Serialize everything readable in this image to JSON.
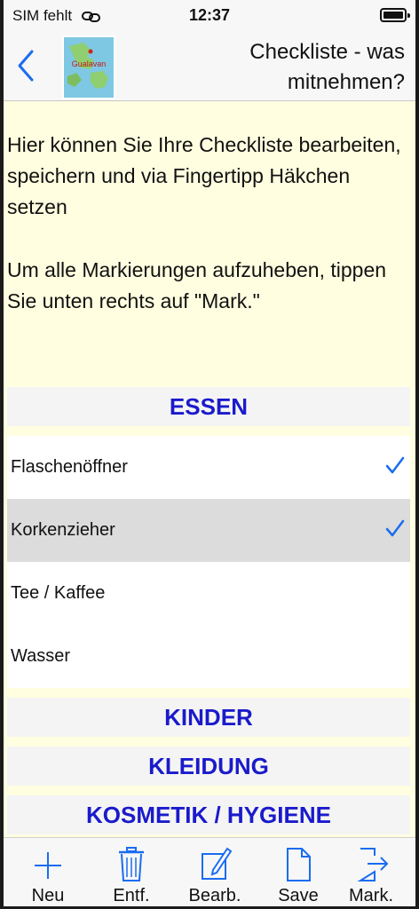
{
  "status_bar": {
    "carrier": "SIM fehlt",
    "link_icon": "link-icon",
    "time": "12:37",
    "battery_icon": "battery-icon"
  },
  "nav": {
    "back_icon": "chevron-left-icon",
    "logo_text": "Gualavan",
    "title": "Checkliste - was mitnehmen?"
  },
  "intro": {
    "paragraph_1": "Hier können Sie Ihre Checkliste bearbeiten, speichern und via Fingertipp Häkchen setzen",
    "paragraph_2": "Um alle Markierungen aufzuheben, tippen Sie unten rechts auf \"Mark.\""
  },
  "checklist": {
    "sections": [
      {
        "title": "ESSEN",
        "items": [
          {
            "label": "Flaschenöffner",
            "checked": true,
            "selected": false
          },
          {
            "label": "Korkenzieher",
            "checked": true,
            "selected": true
          },
          {
            "label": "Tee / Kaffee",
            "checked": false,
            "selected": false
          },
          {
            "label": "Wasser",
            "checked": false,
            "selected": false
          }
        ]
      },
      {
        "title": "KINDER",
        "items": []
      },
      {
        "title": "KLEIDUNG",
        "items": []
      },
      {
        "title": "KOSMETIK / HYGIENE",
        "items": []
      }
    ]
  },
  "toolbar": {
    "new_label": "Neu",
    "delete_label": "Entf.",
    "edit_label": "Bearb.",
    "save_label": "Save",
    "mark_label": "Mark."
  },
  "colors": {
    "accent": "#1a6cf0",
    "section_text": "#1a1acc",
    "background": "#fffee0",
    "selected_row": "#dcdcdc"
  }
}
